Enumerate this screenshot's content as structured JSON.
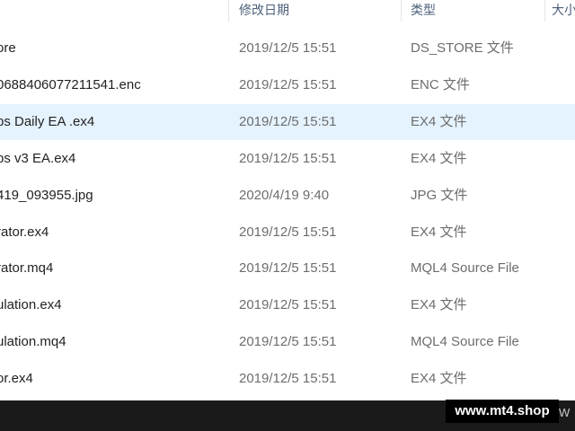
{
  "columns": {
    "date": "修改日期",
    "type": "类型",
    "size": "大小"
  },
  "files": [
    {
      "name": "ore",
      "date": "2019/12/5 15:51",
      "type": "DS_STORE 文件",
      "selected": false
    },
    {
      "name": "0688406077211541.enc",
      "date": "2019/12/5 15:51",
      "type": "ENC 文件",
      "selected": false
    },
    {
      "name": "ps Daily EA .ex4",
      "date": "2019/12/5 15:51",
      "type": "EX4 文件",
      "selected": true
    },
    {
      "name": "ps v3 EA.ex4",
      "date": "2019/12/5 15:51",
      "type": "EX4 文件",
      "selected": false
    },
    {
      "name": "419_093955.jpg",
      "date": "2020/4/19 9:40",
      "type": "JPG 文件",
      "selected": false
    },
    {
      "name": "rator.ex4",
      "date": "2019/12/5 15:51",
      "type": "EX4 文件",
      "selected": false
    },
    {
      "name": "rator.mq4",
      "date": "2019/12/5 15:51",
      "type": "MQL4 Source File",
      "selected": false
    },
    {
      "name": "ulation.ex4",
      "date": "2019/12/5 15:51",
      "type": "EX4 文件",
      "selected": false
    },
    {
      "name": "ulation.mq4",
      "date": "2019/12/5 15:51",
      "type": "MQL4 Source File",
      "selected": false
    },
    {
      "name": "or.ex4",
      "date": "2019/12/5 15:51",
      "type": "EX4 文件",
      "selected": false
    }
  ],
  "watermark": "www.mt4.shop",
  "taskbar_stub": "W"
}
